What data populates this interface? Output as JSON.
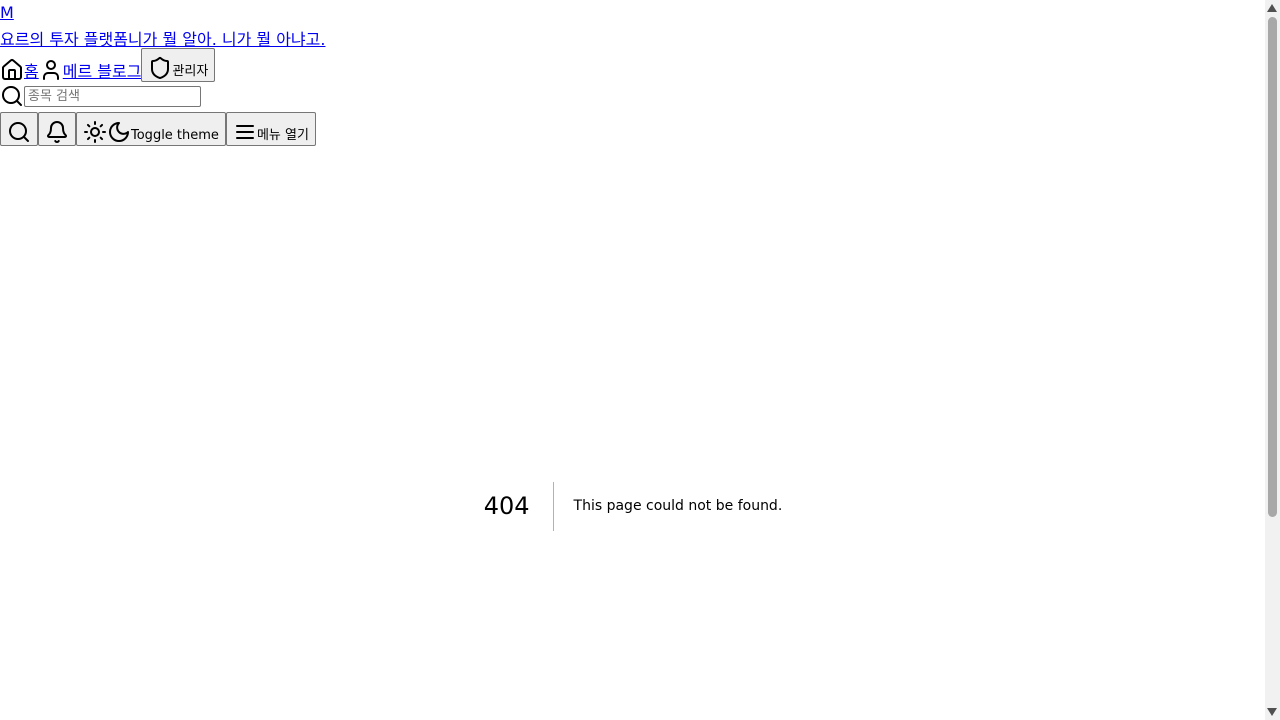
{
  "header": {
    "logo_text": "M",
    "tagline": "요르의 투자 플랫폼니가 뭘 알아. 니가 뭘 아냐고.",
    "nav": {
      "home_label": "홈",
      "blog_label": "메르 블로그",
      "admin_label": "관리자"
    },
    "search": {
      "placeholder": "종목 검색"
    },
    "actions": {
      "theme_label": "Toggle theme",
      "menu_label": "메뉴 열기"
    }
  },
  "not_found": {
    "code": "404",
    "message": "This page could not be found."
  }
}
